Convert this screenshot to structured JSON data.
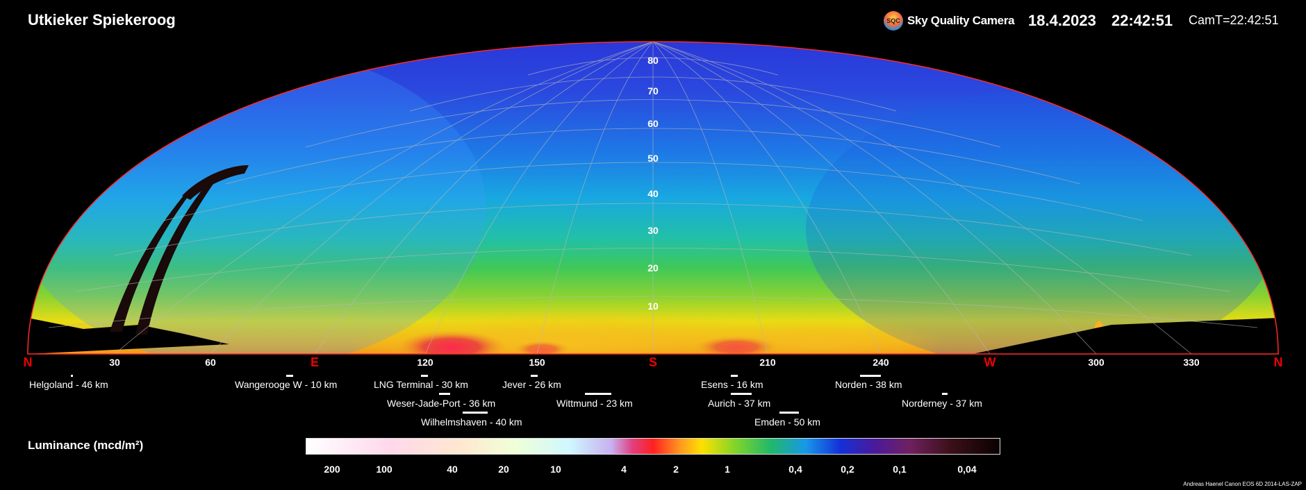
{
  "header": {
    "title": "Utkieker Spiekeroog",
    "brand_logo_text": "SQC",
    "brand_name": "Sky Quality Camera",
    "date": "18.4.2023",
    "time": "22:42:51",
    "cam_time": "CamT=22:42:51"
  },
  "sky_map": {
    "altitude_labels": [
      "10",
      "20",
      "30",
      "40",
      "50",
      "60",
      "70",
      "80"
    ],
    "azimuth_labels": [
      {
        "text": "N",
        "direction": true
      },
      {
        "text": "30",
        "direction": false
      },
      {
        "text": "60",
        "direction": false
      },
      {
        "text": "E",
        "direction": true
      },
      {
        "text": "120",
        "direction": false
      },
      {
        "text": "150",
        "direction": false
      },
      {
        "text": "S",
        "direction": true
      },
      {
        "text": "210",
        "direction": false
      },
      {
        "text": "240",
        "direction": false
      },
      {
        "text": "W",
        "direction": true
      },
      {
        "text": "300",
        "direction": false
      },
      {
        "text": "330",
        "direction": false
      },
      {
        "text": "N",
        "direction": true
      }
    ],
    "colors": {
      "horizon_line": "#ff2a2a",
      "grid": "#b8b8b8",
      "direction_labels": "#e00000"
    }
  },
  "locations": [
    "Helgoland - 46 km",
    "Wangerooge W - 10 km",
    "LNG Terminal - 30 km",
    "Jever - 26 km",
    "Esens - 16 km",
    "Norden - 38 km",
    "Weser-Jade-Port - 36 km",
    "Wittmund - 23 km",
    "Aurich - 37 km",
    "Norderney - 37 km",
    "Wilhelmshaven - 40 km",
    "Emden - 50 km"
  ],
  "legend": {
    "label": "Luminance (mcd/m²)",
    "scale_labels": [
      "200",
      "100",
      "40",
      "20",
      "10",
      "4",
      "2",
      "1",
      "0,4",
      "0,2",
      "0,1",
      "0,04"
    ]
  },
  "footer": {
    "credits": "Andreas Haenel   Canon EOS 6D   2014-LAS-ZAP"
  }
}
